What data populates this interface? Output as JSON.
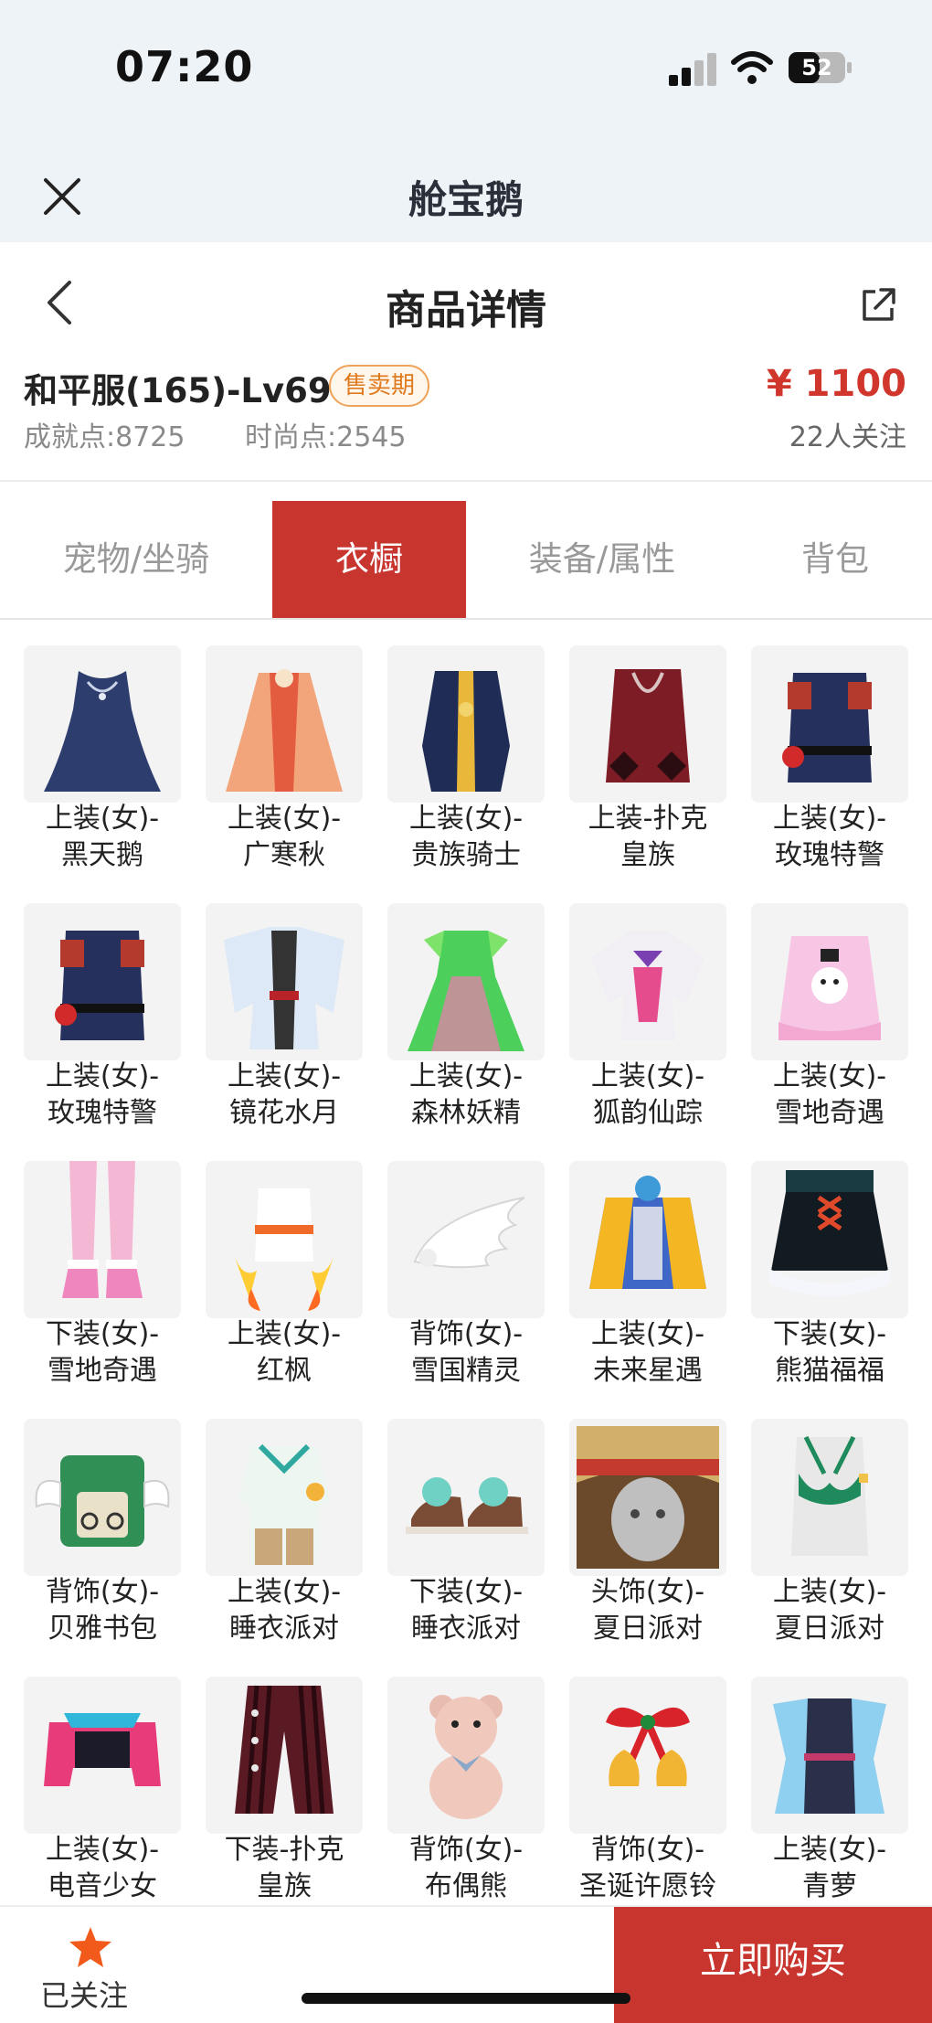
{
  "status": {
    "time": "07:20",
    "battery": "52"
  },
  "app": {
    "title": "舱宝鹅"
  },
  "nav": {
    "title": "商品详情"
  },
  "product": {
    "name": "和平服(165)-Lv69",
    "badge": "售卖期",
    "price": "¥ 1100",
    "achievement": "成就点:8725",
    "fashion": "时尚点:2545",
    "followers": "22人关注"
  },
  "tabs": [
    {
      "label": "宠物/坐骑",
      "active": false
    },
    {
      "label": "衣橱",
      "active": true
    },
    {
      "label": "装备/属性",
      "active": false
    },
    {
      "label": "背包",
      "active": false
    }
  ],
  "wardrobe": [
    {
      "l1": "上装(女)-",
      "l2": "黑天鹅",
      "icon": "dark-blue-dress-icon"
    },
    {
      "l1": "上装(女)-",
      "l2": "广寒秋",
      "icon": "orange-robe-icon"
    },
    {
      "l1": "上装(女)-",
      "l2": "贵族骑士",
      "icon": "knight-coat-icon"
    },
    {
      "l1": "上装-扑克",
      "l2": "皇族",
      "icon": "red-poker-coat-icon"
    },
    {
      "l1": "上装(女)-",
      "l2": "玫瑰特警",
      "icon": "navy-uniform-icon"
    },
    {
      "l1": "上装(女)-",
      "l2": "玫瑰特警",
      "icon": "navy-uniform-icon"
    },
    {
      "l1": "上装(女)-",
      "l2": "镜花水月",
      "icon": "white-kimono-icon"
    },
    {
      "l1": "上装(女)-",
      "l2": "森林妖精",
      "icon": "green-fairy-dress-icon"
    },
    {
      "l1": "上装(女)-",
      "l2": "狐韵仙踪",
      "icon": "white-fox-robe-icon"
    },
    {
      "l1": "上装(女)-",
      "l2": "雪地奇遇",
      "icon": "pink-snow-dress-icon"
    },
    {
      "l1": "下装(女)-",
      "l2": "雪地奇遇",
      "icon": "pink-boots-icon"
    },
    {
      "l1": "上装(女)-",
      "l2": "红枫",
      "icon": "maple-outfit-icon"
    },
    {
      "l1": "背饰(女)-",
      "l2": "雪国精灵",
      "icon": "white-wing-icon"
    },
    {
      "l1": "上装(女)-",
      "l2": "未来星遇",
      "icon": "future-jacket-icon"
    },
    {
      "l1": "下装(女)-",
      "l2": "熊猫福福",
      "icon": "panda-skirt-icon"
    },
    {
      "l1": "背饰(女)-",
      "l2": "贝雅书包",
      "icon": "winged-backpack-icon"
    },
    {
      "l1": "上装(女)-",
      "l2": "睡衣派对",
      "icon": "pajama-top-icon"
    },
    {
      "l1": "下装(女)-",
      "l2": "睡衣派对",
      "icon": "slippers-icon"
    },
    {
      "l1": "头饰(女)-",
      "l2": "夏日派对",
      "icon": "straw-hat-icon"
    },
    {
      "l1": "上装(女)-",
      "l2": "夏日派对",
      "icon": "green-bikini-top-icon"
    },
    {
      "l1": "上装(女)-",
      "l2": "电音少女",
      "icon": "pink-jacket-icon"
    },
    {
      "l1": "下装-扑克",
      "l2": "皇族",
      "icon": "striped-pants-icon"
    },
    {
      "l1": "背饰(女)-",
      "l2": "布偶熊",
      "icon": "teddy-bear-icon"
    },
    {
      "l1": "背饰(女)-",
      "l2": "圣诞许愿铃",
      "icon": "christmas-bell-icon"
    },
    {
      "l1": "上装(女)-",
      "l2": "青萝",
      "icon": "blue-dress-icon"
    }
  ],
  "colors": {
    "accent": "#c8342e",
    "price": "#d0362b",
    "badge": "#e07a1e",
    "star": "#f25a1c"
  },
  "bottom": {
    "follow_label": "已关注",
    "buy_label": "立即购买"
  }
}
